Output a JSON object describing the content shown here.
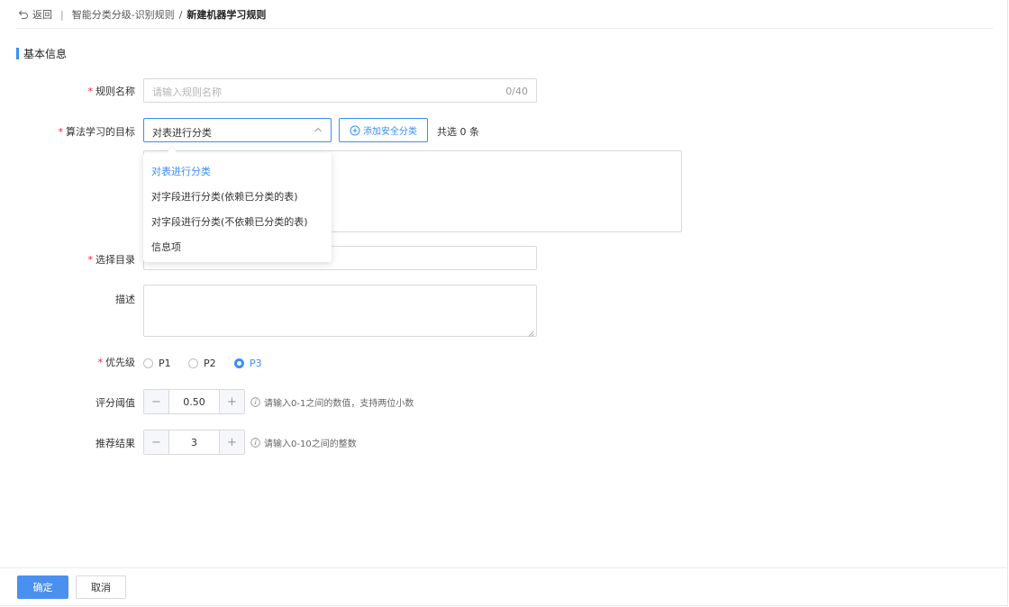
{
  "breadcrumb": {
    "back_label": "返回",
    "separator": "|",
    "path": "智能分类分级-识别规则",
    "slash": "/",
    "current": "新建机器学习规则"
  },
  "section": {
    "title": "基本信息"
  },
  "form": {
    "required_mark": "*",
    "rule_name": {
      "label": "规则名称",
      "placeholder": "请输入规则名称",
      "counter": "0/40"
    },
    "goal": {
      "label": "算法学习的目标",
      "selected": "对表进行分类",
      "add_button": "添加安全分类",
      "total": "共选 0 条",
      "options": [
        "对表进行分类",
        "对字段进行分类(依赖已分类的表)",
        "对字段进行分类(不依赖已分类的表)",
        "信息项"
      ]
    },
    "catalog": {
      "label": "选择目录"
    },
    "description": {
      "label": "描述"
    },
    "priority": {
      "label": "优先级",
      "options": [
        "P1",
        "P2",
        "P3"
      ],
      "selected": "P3"
    },
    "threshold": {
      "label": "评分阈值",
      "value": "0.50",
      "minus": "−",
      "plus": "+",
      "hint": "请输入0-1之间的数值，支持两位小数"
    },
    "recommend": {
      "label": "推荐结果",
      "value": "3",
      "minus": "−",
      "plus": "+",
      "hint": "请输入0-10之间的整数"
    }
  },
  "footer": {
    "confirm": "确定",
    "cancel": "取消"
  },
  "colors": {
    "accent": "#3a8ef6",
    "required": "#f5222d"
  }
}
